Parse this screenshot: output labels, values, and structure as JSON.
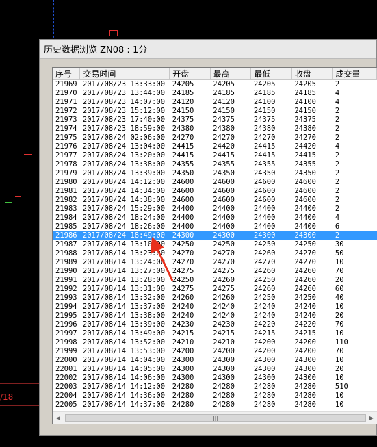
{
  "window": {
    "title": "历史数据浏览 ZN08 : 1分"
  },
  "columns": [
    "序号",
    "交易时间",
    "开盘",
    "最高",
    "最低",
    "收盘",
    "成交量"
  ],
  "rows": [
    [
      "21969",
      "2017/08/23 13:33:00",
      "24205",
      "24205",
      "24205",
      "24205",
      "2"
    ],
    [
      "21970",
      "2017/08/23 13:44:00",
      "24185",
      "24185",
      "24185",
      "24185",
      "4"
    ],
    [
      "21971",
      "2017/08/23 14:07:00",
      "24120",
      "24120",
      "24100",
      "24100",
      "4"
    ],
    [
      "21972",
      "2017/08/23 15:12:00",
      "24150",
      "24150",
      "24150",
      "24150",
      "2"
    ],
    [
      "21973",
      "2017/08/23 17:40:00",
      "24375",
      "24375",
      "24375",
      "24375",
      "2"
    ],
    [
      "21974",
      "2017/08/23 18:59:00",
      "24380",
      "24380",
      "24380",
      "24380",
      "2"
    ],
    [
      "21975",
      "2017/08/24 02:06:00",
      "24270",
      "24270",
      "24270",
      "24270",
      "2"
    ],
    [
      "21976",
      "2017/08/24 13:04:00",
      "24415",
      "24420",
      "24415",
      "24420",
      "4"
    ],
    [
      "21977",
      "2017/08/24 13:20:00",
      "24415",
      "24415",
      "24415",
      "24415",
      "2"
    ],
    [
      "21978",
      "2017/08/24 13:38:00",
      "24355",
      "24355",
      "24355",
      "24355",
      "2"
    ],
    [
      "21979",
      "2017/08/24 13:39:00",
      "24350",
      "24350",
      "24350",
      "24350",
      "2"
    ],
    [
      "21980",
      "2017/08/24 14:12:00",
      "24600",
      "24600",
      "24600",
      "24600",
      "2"
    ],
    [
      "21981",
      "2017/08/24 14:34:00",
      "24600",
      "24600",
      "24600",
      "24600",
      "2"
    ],
    [
      "21982",
      "2017/08/24 14:38:00",
      "24600",
      "24600",
      "24600",
      "24600",
      "2"
    ],
    [
      "21983",
      "2017/08/24 15:29:00",
      "24400",
      "24400",
      "24400",
      "24400",
      "2"
    ],
    [
      "21984",
      "2017/08/24 18:24:00",
      "24400",
      "24400",
      "24400",
      "24400",
      "4"
    ],
    [
      "21985",
      "2017/08/24 18:26:00",
      "24400",
      "24400",
      "24400",
      "24400",
      "6"
    ],
    [
      "21986",
      "2017/08/24 18:49:00",
      "24300",
      "24300",
      "24300",
      "24300",
      "2"
    ],
    [
      "21987",
      "2017/08/14 13:10:00",
      "24250",
      "24250",
      "24250",
      "24250",
      "30"
    ],
    [
      "21988",
      "2017/08/14 13:23:00",
      "24270",
      "24270",
      "24260",
      "24270",
      "50"
    ],
    [
      "21989",
      "2017/08/14 13:24:00",
      "24270",
      "24270",
      "24270",
      "24270",
      "10"
    ],
    [
      "21990",
      "2017/08/14 13:27:00",
      "24275",
      "24275",
      "24260",
      "24260",
      "70"
    ],
    [
      "21991",
      "2017/08/14 13:28:00",
      "24250",
      "24260",
      "24250",
      "24260",
      "20"
    ],
    [
      "21992",
      "2017/08/14 13:31:00",
      "24275",
      "24275",
      "24260",
      "24260",
      "60"
    ],
    [
      "21993",
      "2017/08/14 13:32:00",
      "24260",
      "24260",
      "24250",
      "24250",
      "40"
    ],
    [
      "21994",
      "2017/08/14 13:37:00",
      "24240",
      "24240",
      "24240",
      "24240",
      "10"
    ],
    [
      "21995",
      "2017/08/14 13:38:00",
      "24240",
      "24240",
      "24240",
      "24240",
      "20"
    ],
    [
      "21996",
      "2017/08/14 13:39:00",
      "24230",
      "24230",
      "24220",
      "24220",
      "70"
    ],
    [
      "21997",
      "2017/08/14 13:49:00",
      "24215",
      "24215",
      "24215",
      "24215",
      "10"
    ],
    [
      "21998",
      "2017/08/14 13:52:00",
      "24210",
      "24210",
      "24200",
      "24200",
      "110"
    ],
    [
      "21999",
      "2017/08/14 13:53:00",
      "24200",
      "24200",
      "24200",
      "24200",
      "70"
    ],
    [
      "22000",
      "2017/08/14 14:04:00",
      "24300",
      "24300",
      "24300",
      "24300",
      "10"
    ],
    [
      "22001",
      "2017/08/14 14:05:00",
      "24300",
      "24300",
      "24300",
      "24300",
      "20"
    ],
    [
      "22002",
      "2017/08/14 14:06:00",
      "24300",
      "24300",
      "24300",
      "24300",
      "10"
    ],
    [
      "22003",
      "2017/08/14 14:12:00",
      "24280",
      "24280",
      "24280",
      "24280",
      "510"
    ],
    [
      "22004",
      "2017/08/14 14:36:00",
      "24280",
      "24280",
      "24280",
      "24280",
      "10"
    ],
    [
      "22005",
      "2017/08/14 14:37:00",
      "24280",
      "24280",
      "24280",
      "24280",
      "10"
    ]
  ],
  "selected_index": 17,
  "background": {
    "side_label": "/18"
  },
  "colors": {
    "selection": "#3399ff",
    "annotation_arrow": "#e8301c",
    "background_chart": "#000000",
    "chart_lines": "#e03030"
  }
}
